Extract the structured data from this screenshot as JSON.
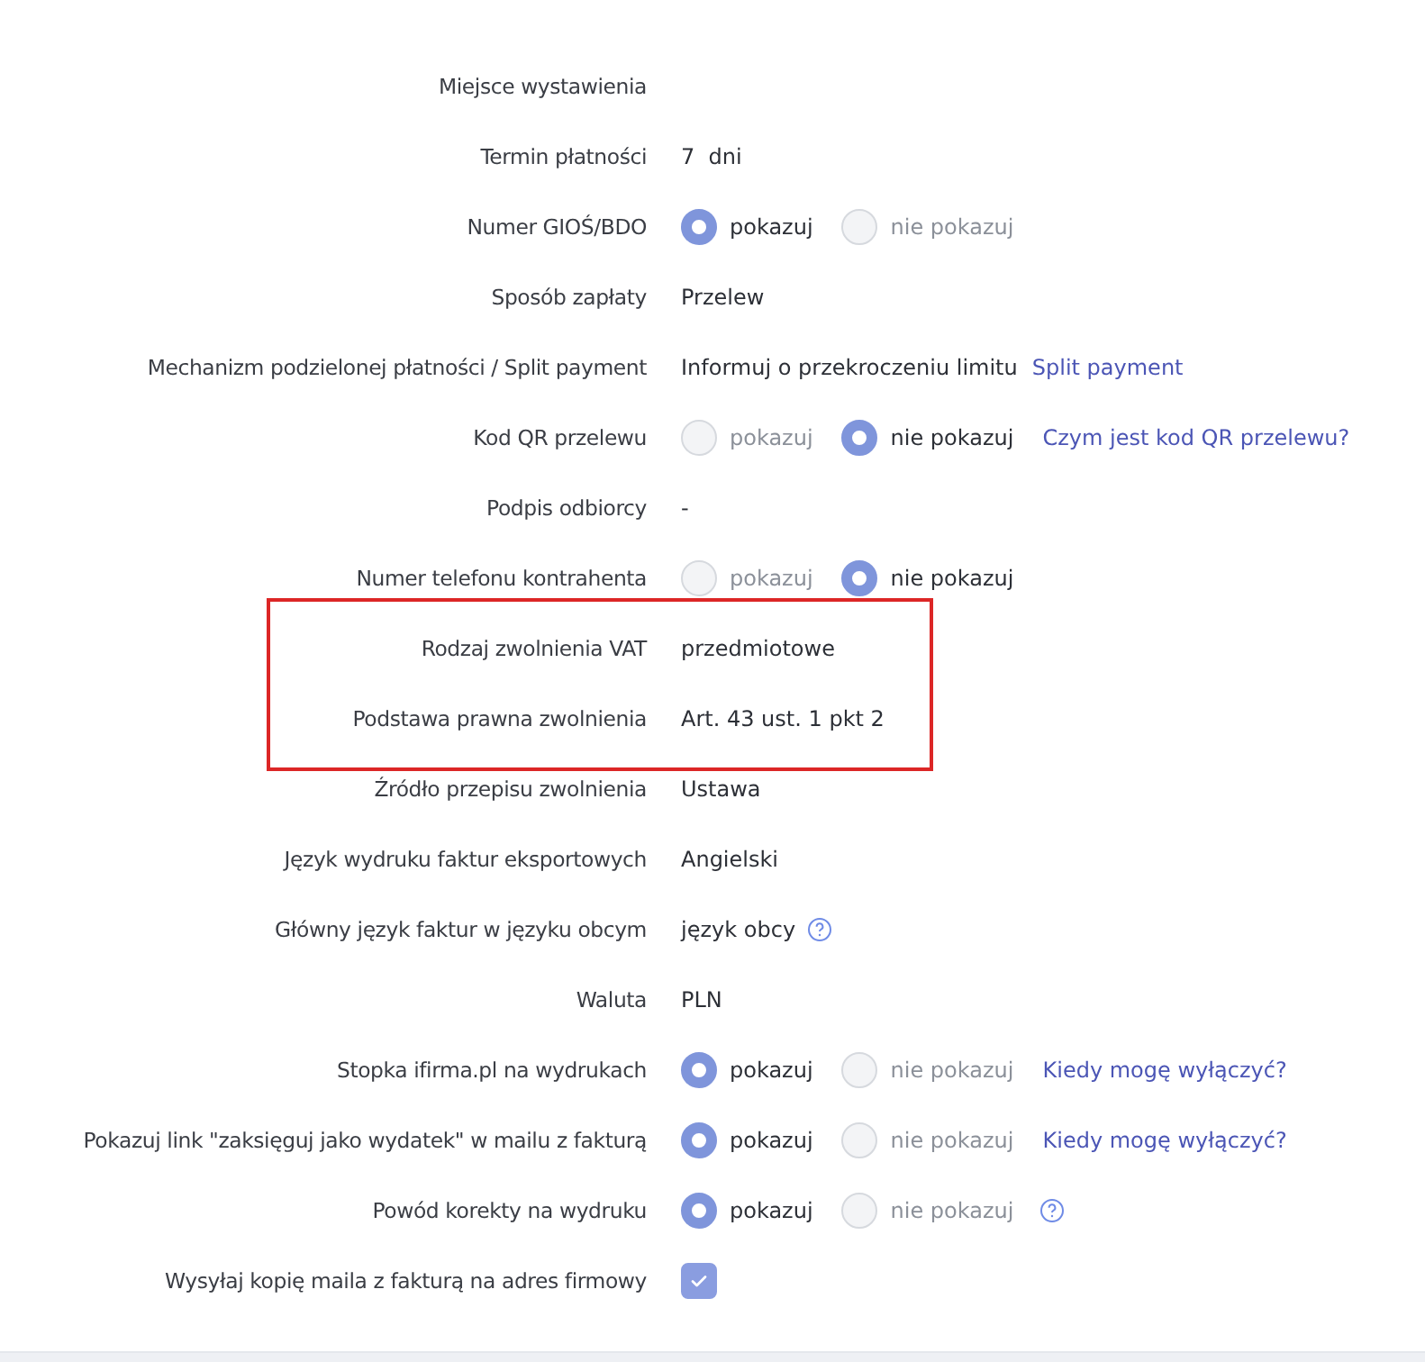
{
  "rows": [
    {
      "label": "Miejsce wystawienia",
      "kind": "text",
      "highlighted": false
    },
    {
      "label": "Termin płatności",
      "kind": "text",
      "value": "7  dni",
      "highlighted": false
    },
    {
      "label": "Numer GIOŚ/BDO",
      "kind": "radio",
      "options": [
        {
          "label": "pokazuj",
          "selected": true
        },
        {
          "label": "nie pokazuj",
          "selected": false
        }
      ],
      "highlighted": false
    },
    {
      "label": "Sposób zapłaty",
      "kind": "text",
      "value": "Przelew",
      "highlighted": false
    },
    {
      "label": "Mechanizm podzielonej płatności / Split payment",
      "kind": "text",
      "value": "Informuj o przekroczeniu limitu",
      "link": "Split payment",
      "highlighted": false
    },
    {
      "label": "Kod QR przelewu",
      "kind": "radio",
      "options": [
        {
          "label": "pokazuj",
          "selected": false
        },
        {
          "label": "nie pokazuj",
          "selected": true
        }
      ],
      "link": "Czym jest kod QR przelewu?",
      "highlighted": false
    },
    {
      "label": "Podpis odbiorcy",
      "kind": "text",
      "value": "-",
      "highlighted": false
    },
    {
      "label": "Numer telefonu kontrahenta",
      "kind": "radio",
      "options": [
        {
          "label": "pokazuj",
          "selected": false
        },
        {
          "label": "nie pokazuj",
          "selected": true
        }
      ],
      "highlighted": false
    },
    {
      "label": "Rodzaj zwolnienia VAT",
      "kind": "text",
      "value": "przedmiotowe",
      "highlighted": true
    },
    {
      "label": "Podstawa prawna zwolnienia",
      "kind": "text",
      "value": "Art. 43 ust. 1 pkt 2",
      "highlighted": true
    },
    {
      "label": "Źródło przepisu zwolnienia",
      "kind": "text",
      "value": "Ustawa",
      "highlighted": false
    },
    {
      "label": "Język wydruku faktur eksportowych",
      "kind": "text",
      "value": "Angielski",
      "highlighted": false
    },
    {
      "label": "Główny język faktur w języku obcym",
      "kind": "text",
      "value": "język obcy",
      "help": true,
      "highlighted": false
    },
    {
      "label": "Waluta",
      "kind": "text",
      "value": "PLN",
      "highlighted": false
    },
    {
      "label": "Stopka ifirma.pl na wydrukach",
      "kind": "radio",
      "options": [
        {
          "label": "pokazuj",
          "selected": true
        },
        {
          "label": "nie pokazuj",
          "selected": false
        }
      ],
      "link": "Kiedy mogę wyłączyć?",
      "highlighted": false
    },
    {
      "label": "Pokazuj link \"zaksięguj jako wydatek\" w mailu z fakturą",
      "kind": "radio",
      "options": [
        {
          "label": "pokazuj",
          "selected": true
        },
        {
          "label": "nie pokazuj",
          "selected": false
        }
      ],
      "link": "Kiedy mogę wyłączyć?",
      "highlighted": false
    },
    {
      "label": "Powód korekty na wydruku",
      "kind": "radio",
      "options": [
        {
          "label": "pokazuj",
          "selected": true
        },
        {
          "label": "nie pokazuj",
          "selected": false
        }
      ],
      "help": true,
      "highlighted": false
    },
    {
      "label": "Wysyłaj kopię maila z fakturą na adres firmowy",
      "kind": "checkbox",
      "checked": true,
      "highlighted": false
    }
  ]
}
